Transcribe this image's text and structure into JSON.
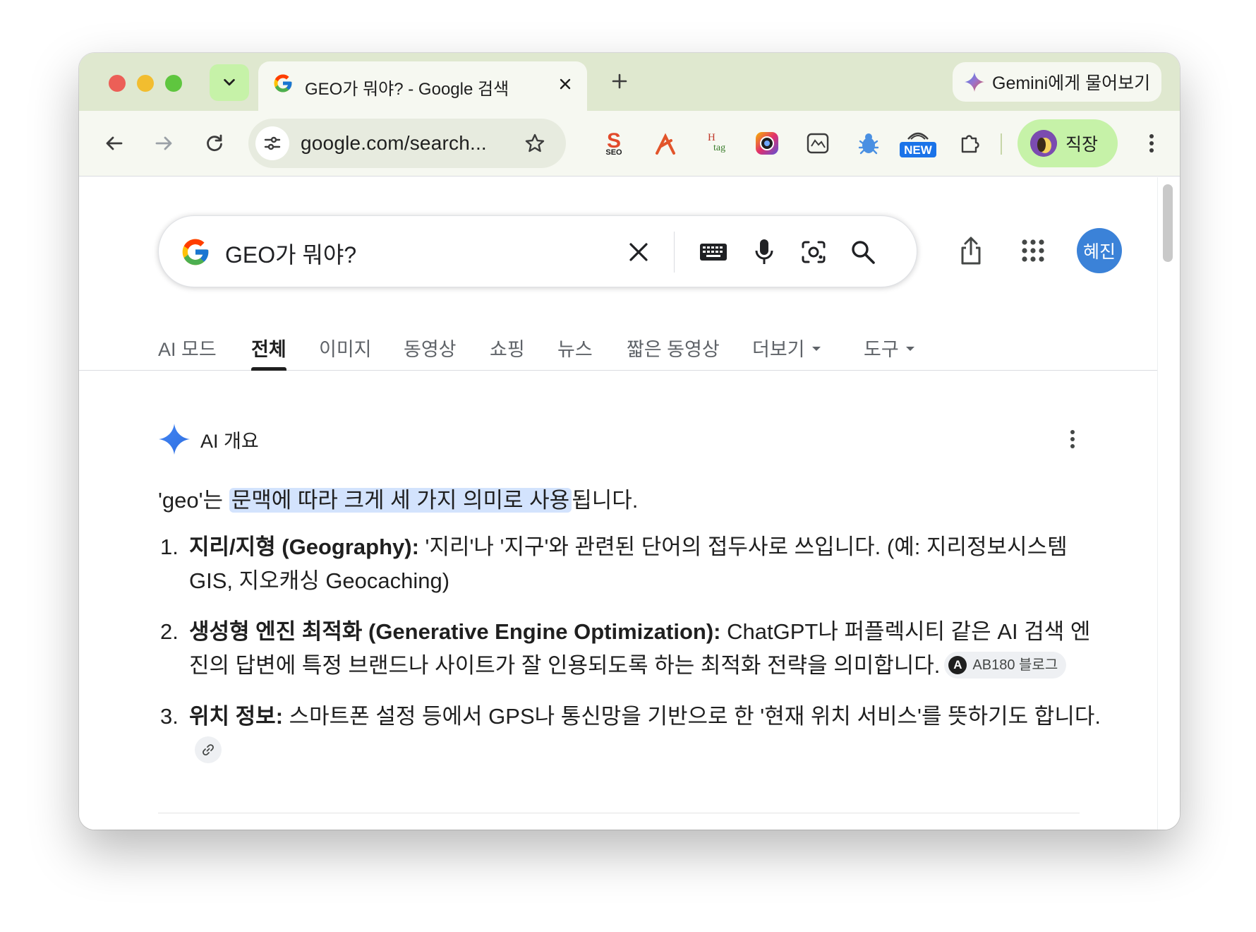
{
  "browser": {
    "tab": {
      "title": "GEO가 뭐야? - Google 검색"
    },
    "gemini_button": {
      "label": "Gemini에게 물어보기"
    },
    "omnibox": {
      "url": "google.com/search..."
    },
    "extensions": [
      {
        "name": "seo-extension",
        "badge": "SEO"
      },
      {
        "name": "tool-extension"
      },
      {
        "name": "hashtag-extension",
        "badge": "tag"
      },
      {
        "name": "camera-extension"
      },
      {
        "name": "screenshot-extension"
      },
      {
        "name": "bug-extension"
      },
      {
        "name": "new-extension",
        "badge": "NEW"
      },
      {
        "name": "puzzle-extensions-menu"
      }
    ],
    "profile": {
      "label": "직장"
    }
  },
  "search": {
    "query": "GEO가 뭐야?",
    "account_initials": "혜진"
  },
  "nav_tabs": {
    "ai_mode": "AI 모드",
    "all": "전체",
    "images": "이미지",
    "videos": "동영상",
    "shopping": "쇼핑",
    "news": "뉴스",
    "short_videos": "짧은 동영상",
    "more": "더보기",
    "tools": "도구"
  },
  "ai_overview": {
    "title": "AI 개요",
    "intro_prefix": "'geo'는 ",
    "intro_highlight": "문맥에 따라 크게 세 가지 의미로 사용",
    "intro_suffix": "됩니다.",
    "items": [
      {
        "num": "1.",
        "term": "지리/지형 (Geography):",
        "text": " '지리'나 '지구'와 관련된 단어의 접두사로 쓰입니다. (예: 지리정보시스템 GIS, 지오캐싱 Geocaching)"
      },
      {
        "num": "2.",
        "term": "생성형 엔진 최적화 (Generative Engine Optimization):",
        "text": " ChatGPT나 퍼플렉시티 같은 AI 검색 엔진의 답변에 특정 브랜드나 사이트가 잘 인용되도록 하는 최적화 전략을 의미합니다.",
        "source_logo": "A",
        "source": "AB180 블로그"
      },
      {
        "num": "3.",
        "term": "위치 정보:",
        "text": " 스마트폰 설정 등에서 GPS나 통신망을 기반으로 한 '현재 위치 서비스'를 뜻하기도 합니다."
      }
    ]
  },
  "colors": {
    "tabstrip_bg": "#dfe8cf",
    "toolbar_bg": "#f6f8f1",
    "accent_green": "#c6f2a8",
    "highlight": "#d3e3fd",
    "avatar_blue": "#3b82d8"
  }
}
